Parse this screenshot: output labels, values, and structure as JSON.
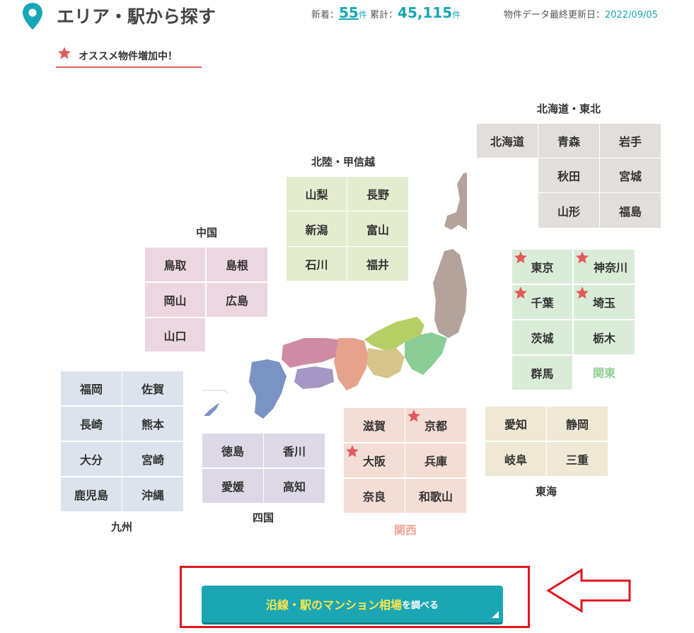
{
  "header": {
    "title": "エリア・駅から探す",
    "new_label": "新着：",
    "new_count": "55",
    "new_unit": "件",
    "total_label": "累計：",
    "total_count": "45,115",
    "total_unit": "件",
    "updated_label": "物件データ最終更新日：",
    "updated_date": "2022/09/05"
  },
  "recommend": {
    "label": "オススメ物件増加中！"
  },
  "regions": {
    "hokkaido_tohoku": {
      "label": "北海道・東北",
      "prefs": [
        "北海道",
        "青森",
        "岩手",
        "秋田",
        "宮城",
        "山形",
        "福島"
      ]
    },
    "hokuriku": {
      "label": "北陸・甲信越",
      "prefs": [
        "山梨",
        "長野",
        "新潟",
        "富山",
        "石川",
        "福井"
      ]
    },
    "chugoku": {
      "label": "中国",
      "prefs": [
        "鳥取",
        "島根",
        "岡山",
        "広島",
        "山口"
      ]
    },
    "kanto": {
      "label": "関東",
      "prefs": [
        "東京",
        "神奈川",
        "千葉",
        "埼玉",
        "茨城",
        "栃木",
        "群馬"
      ]
    },
    "kyushu": {
      "label": "九州",
      "prefs": [
        "福岡",
        "佐賀",
        "長崎",
        "熊本",
        "大分",
        "宮崎",
        "鹿児島",
        "沖縄"
      ]
    },
    "shikoku": {
      "label": "四国",
      "prefs": [
        "徳島",
        "香川",
        "愛媛",
        "高知"
      ]
    },
    "kansai": {
      "label": "関西",
      "prefs": [
        "滋賀",
        "京都",
        "大阪",
        "兵庫",
        "奈良",
        "和歌山"
      ]
    },
    "tokai": {
      "label": "東海",
      "prefs": [
        "愛知",
        "静岡",
        "岐阜",
        "三重"
      ]
    }
  },
  "recommended_prefs": [
    "東京",
    "神奈川",
    "千葉",
    "埼玉",
    "京都",
    "大阪"
  ],
  "cta": {
    "main": "沿線・駅のマンション相場",
    "suffix": "を調べる"
  },
  "colors": {
    "accent": "#1ba6b4",
    "star": "#e25b5b",
    "hokkaido_tohoku": "#e2dedb",
    "hokuriku": "#e4eccf",
    "chugoku": "#ecd6df",
    "kanto": "#d9ecd8",
    "kyushu": "#dce3ec",
    "shikoku": "#ddd8e6",
    "kansai": "#f4ddd5",
    "tokai": "#efe8d4",
    "highlight_box": "#e2141c"
  }
}
